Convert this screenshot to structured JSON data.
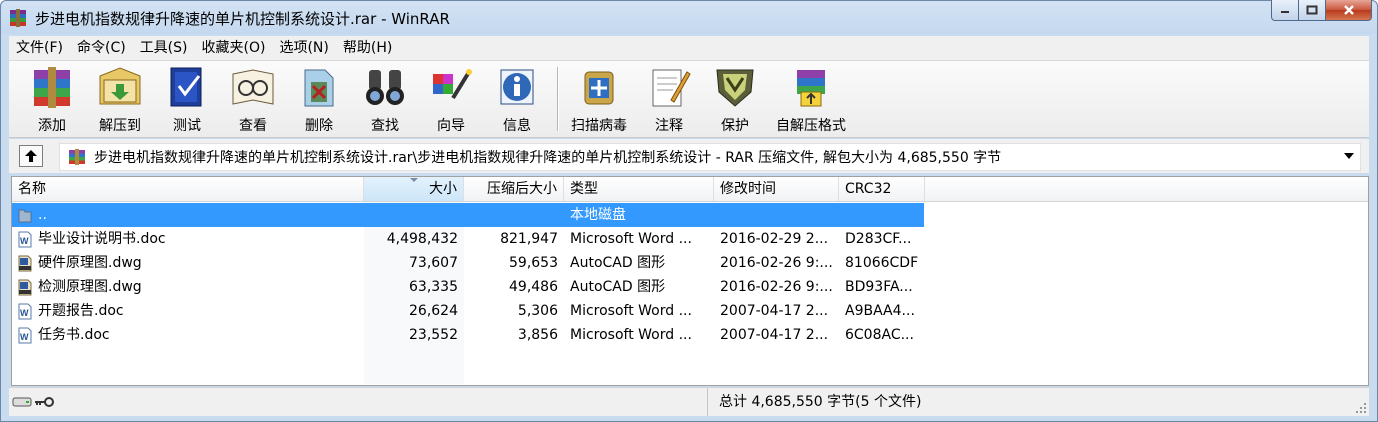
{
  "window": {
    "title": "步进电机指数规律升降速的单片机控制系统设计.rar - WinRAR"
  },
  "menu": [
    "文件(F)",
    "命令(C)",
    "工具(S)",
    "收藏夹(O)",
    "选项(N)",
    "帮助(H)"
  ],
  "toolbar": [
    {
      "label": "添加",
      "icon": "add-archive-icon"
    },
    {
      "label": "解压到",
      "icon": "extract-to-icon"
    },
    {
      "label": "测试",
      "icon": "test-icon"
    },
    {
      "label": "查看",
      "icon": "view-icon"
    },
    {
      "label": "删除",
      "icon": "delete-icon"
    },
    {
      "label": "查找",
      "icon": "find-icon"
    },
    {
      "label": "向导",
      "icon": "wizard-icon"
    },
    {
      "label": "信息",
      "icon": "info-icon"
    },
    {
      "label": "扫描病毒",
      "icon": "virus-scan-icon"
    },
    {
      "label": "注释",
      "icon": "comment-icon"
    },
    {
      "label": "保护",
      "icon": "protect-icon"
    },
    {
      "label": "自解压格式",
      "icon": "sfx-icon"
    }
  ],
  "address": {
    "path": "步进电机指数规律升降速的单片机控制系统设计.rar\\步进电机指数规律升降速的单片机控制系统设计 - RAR 压缩文件, 解包大小为 4,685,550 字节"
  },
  "columns": [
    "名称",
    "大小",
    "压缩后大小",
    "类型",
    "修改时间",
    "CRC32"
  ],
  "rows": [
    {
      "name": "..",
      "size": "",
      "packed": "",
      "type": "本地磁盘",
      "modified": "",
      "crc": "",
      "icon": "folder-up-icon"
    },
    {
      "name": "毕业设计说明书.doc",
      "size": "4,498,432",
      "packed": "821,947",
      "type": "Microsoft Word ...",
      "modified": "2016-02-29 2...",
      "crc": "D283CF...",
      "icon": "word-doc-icon"
    },
    {
      "name": "硬件原理图.dwg",
      "size": "73,607",
      "packed": "59,653",
      "type": "AutoCAD 图形",
      "modified": "2016-02-26 9:...",
      "crc": "81066CDF",
      "icon": "dwg-file-icon"
    },
    {
      "name": "检测原理图.dwg",
      "size": "63,335",
      "packed": "49,486",
      "type": "AutoCAD 图形",
      "modified": "2016-02-26 9:...",
      "crc": "BD93FA...",
      "icon": "dwg-file-icon"
    },
    {
      "name": "开题报告.doc",
      "size": "26,624",
      "packed": "5,306",
      "type": "Microsoft Word ...",
      "modified": "2007-04-17 2...",
      "crc": "A9BAA4...",
      "icon": "word-doc-icon"
    },
    {
      "name": "任务书.doc",
      "size": "23,552",
      "packed": "3,856",
      "type": "Microsoft Word ...",
      "modified": "2007-04-17 2...",
      "crc": "6C08AC...",
      "icon": "word-doc-icon"
    }
  ],
  "status": {
    "total": "总计 4,685,550 字节(5 个文件)"
  },
  "colors": {
    "selection": "#3399ff",
    "menubar": "#f0f0f0"
  }
}
